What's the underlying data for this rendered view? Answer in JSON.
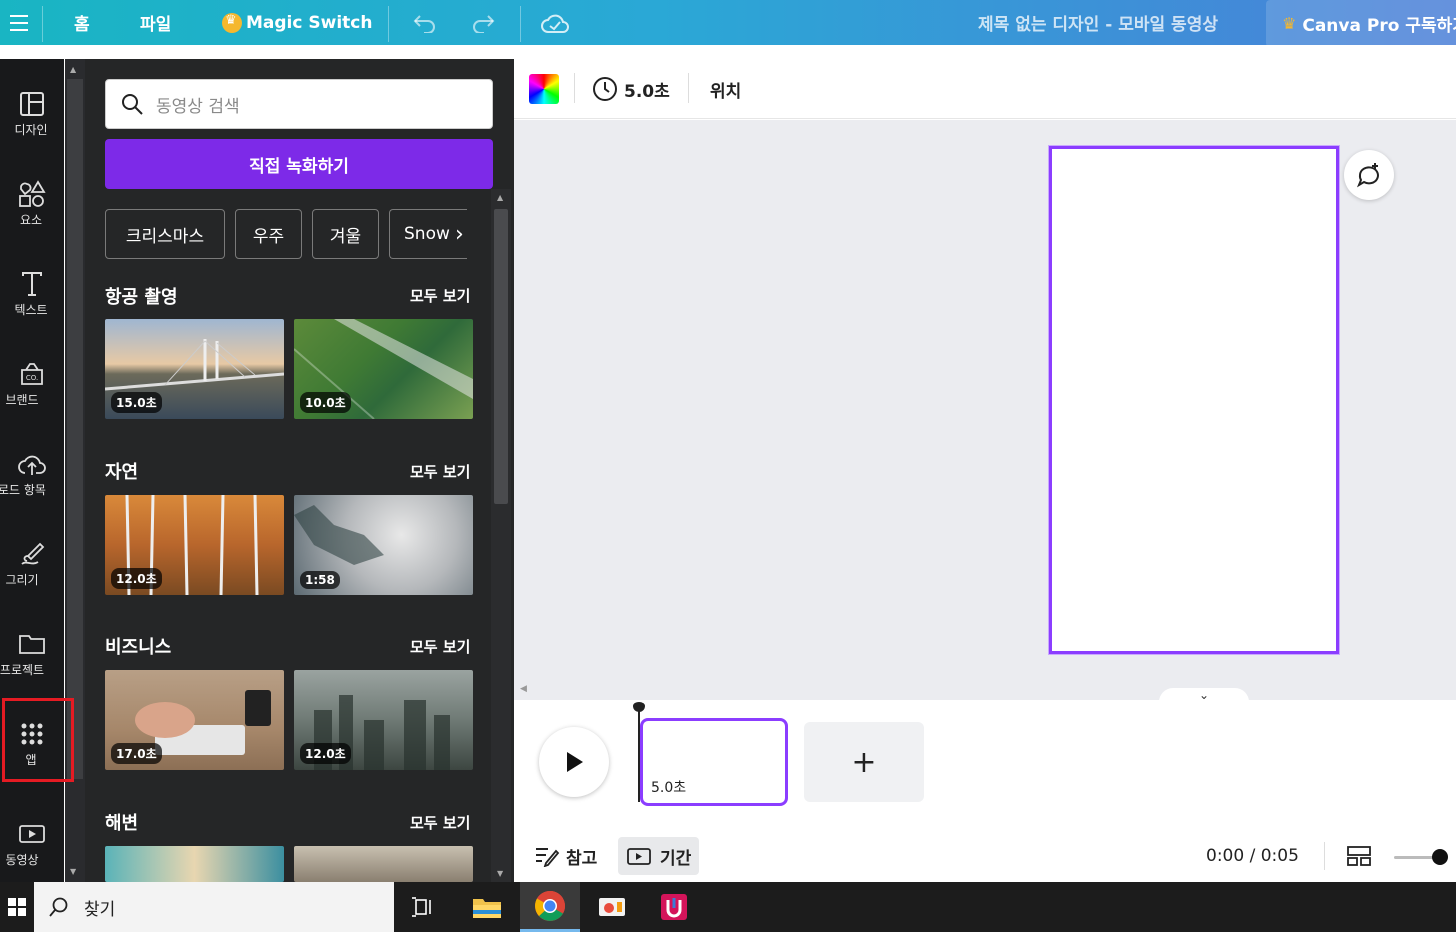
{
  "topbar": {
    "home_label": "홈",
    "file_label": "파일",
    "magic_switch_label": "Magic Switch",
    "doc_title": "제목 없는 디자인 - 모바일 동영상",
    "pro_label": "Canva Pro 구독하기"
  },
  "rail": {
    "items": [
      {
        "label": "디자인",
        "icon": "layout-icon"
      },
      {
        "label": "요소",
        "icon": "shapes-icon"
      },
      {
        "label": "텍스트",
        "icon": "text-icon"
      },
      {
        "label": "브랜드",
        "icon": "brand-icon"
      },
      {
        "label": "로드 항목",
        "icon": "upload-icon"
      },
      {
        "label": "그리기",
        "icon": "draw-icon"
      },
      {
        "label": "프로젝트",
        "icon": "folder-icon"
      },
      {
        "label": "앱",
        "icon": "apps-icon"
      },
      {
        "label": "동영상",
        "icon": "video-icon"
      }
    ]
  },
  "panel": {
    "search_placeholder": "동영상 검색",
    "record_label": "직접 녹화하기",
    "chips": [
      "크리스마스",
      "우주",
      "겨울",
      "Snow"
    ],
    "see_all": "모두 보기",
    "sections": [
      {
        "title": "항공 촬영",
        "durations": [
          "15.0초",
          "10.0초"
        ]
      },
      {
        "title": "자연",
        "durations": [
          "12.0초",
          "1:58"
        ]
      },
      {
        "title": "비즈니스",
        "durations": [
          "17.0초",
          "12.0초"
        ]
      },
      {
        "title": "해변",
        "durations": [
          "",
          ""
        ]
      }
    ]
  },
  "toolbar": {
    "duration_label": "5.0초",
    "position_label": "위치"
  },
  "timeline": {
    "clip_duration": "5.0초",
    "add_label": "+"
  },
  "bottombar": {
    "notes_label": "참고",
    "duration_label": "기간",
    "time": "0:00 / 0:05"
  },
  "taskbar": {
    "search_placeholder": "찾기"
  },
  "colors": {
    "accent": "#8b3dff",
    "record_button": "#7d2ae8",
    "highlight": "#e51b23"
  }
}
